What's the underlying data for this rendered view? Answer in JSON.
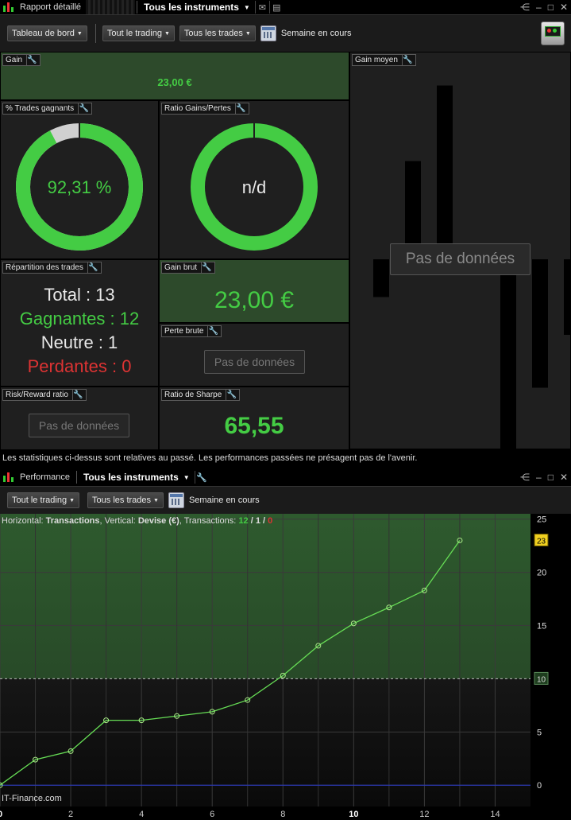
{
  "window1": {
    "title": "Rapport détaillé",
    "instrument": "Tous les instruments",
    "caret": "▼"
  },
  "toolbar1": {
    "dashboard": "Tableau de bord",
    "trading": "Tout le trading",
    "trades": "Tous les trades",
    "period": "Semaine en cours"
  },
  "tiles": {
    "gain": {
      "label": "Gain",
      "value": "23,00 €"
    },
    "gain_moyen": {
      "label": "Gain moyen",
      "nodata": "Pas de données",
      "bars": [
        -5,
        13,
        23,
        0,
        -27,
        -17,
        -10
      ]
    },
    "pct_trades": {
      "label": "% Trades gagnants",
      "value": "92,31 %",
      "fraction": 0.9231
    },
    "ratio_gp": {
      "label": "Ratio Gains/Pertes",
      "value": "n/d"
    },
    "repartition": {
      "label": "Répartition des trades",
      "total": "Total : 13",
      "gagnantes": "Gagnantes : 12",
      "neutre": "Neutre : 1",
      "perdantes": "Perdantes : 0"
    },
    "gain_brut": {
      "label": "Gain brut",
      "value": "23,00 €"
    },
    "perte_brute": {
      "label": "Perte brute",
      "nodata": "Pas de données"
    },
    "risk_reward": {
      "label": "Risk/Reward ratio",
      "nodata": "Pas de données"
    },
    "sharpe": {
      "label": "Ratio de Sharpe",
      "value": "65,55"
    }
  },
  "disclaimer": "Les statistiques ci-dessus sont relatives au passé. Les performances passées ne présagent pas de l'avenir.",
  "window2": {
    "title": "Performance",
    "instrument": "Tous les instruments",
    "caret": "▼"
  },
  "toolbar2": {
    "trading": "Tout le trading",
    "trades": "Tous les trades",
    "period": "Semaine en cours"
  },
  "colors": {
    "green": "#44cc44",
    "red": "#dd3333",
    "dark_green": "#2d4a2b"
  },
  "chart_data": {
    "type": "line",
    "header": {
      "h_label": "Horizontal:",
      "h_value": "Transactions",
      "v_label": ", Vertical:",
      "v_value": "Devise (€)",
      "t_label": ", Transactions:",
      "wins": "12",
      "sep1": " / ",
      "neutral": "1",
      "sep2": " / ",
      "losses": "0"
    },
    "x": [
      0,
      1,
      2,
      3,
      4,
      5,
      6,
      7,
      8,
      9,
      10,
      11,
      12,
      13
    ],
    "values": [
      0,
      2.4,
      3.2,
      6.1,
      6.1,
      6.5,
      6.9,
      8.0,
      10.3,
      13.1,
      15.2,
      16.7,
      18.3,
      23.0
    ],
    "xlim": [
      0,
      15
    ],
    "ylim": [
      -2,
      25.5
    ],
    "xticks": [
      "0",
      "2",
      "4",
      "6",
      "8",
      "10",
      "12",
      "14"
    ],
    "xtick_values": [
      0,
      2,
      4,
      6,
      8,
      10,
      12,
      14
    ],
    "yticks": [
      "0",
      "5",
      "15",
      "20",
      "25"
    ],
    "ytick_values": [
      0,
      5,
      15,
      20,
      25
    ],
    "last_label": "23",
    "last_value": 23,
    "mid_label": "10",
    "mid_value": 10,
    "watermark": "IT-Finance.com"
  }
}
